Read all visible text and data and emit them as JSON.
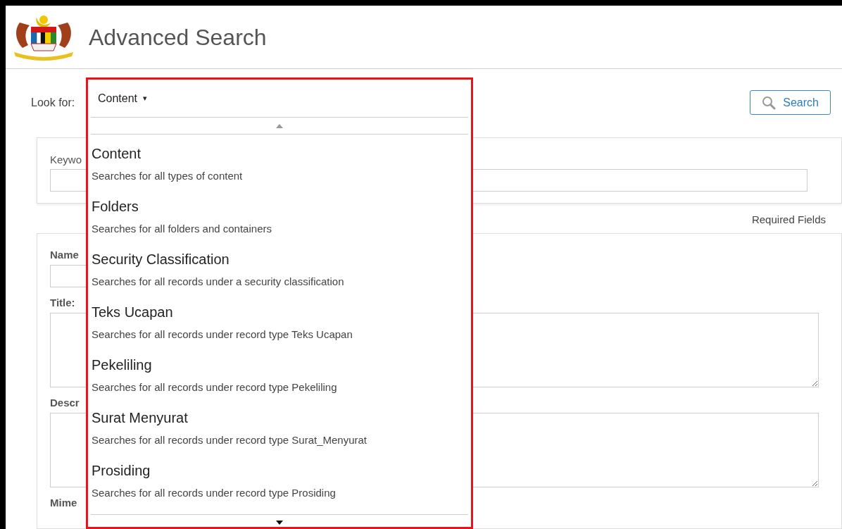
{
  "header": {
    "title": "Advanced Search"
  },
  "look_for": {
    "label": "Look for:",
    "value": "Content",
    "caret": "▾"
  },
  "search_button": {
    "label": "Search"
  },
  "dropdown": {
    "options": [
      {
        "label": "Content",
        "description": "Searches for all types of content"
      },
      {
        "label": "Folders",
        "description": "Searches for all folders and containers"
      },
      {
        "label": "Security Classification",
        "description": "Searches for all records under a security classification"
      },
      {
        "label": "Teks Ucapan",
        "description": "Searches for all records under record type Teks Ucapan"
      },
      {
        "label": "Pekeliling",
        "description": "Searches for all records under record type Pekeliling"
      },
      {
        "label": "Surat Menyurat",
        "description": "Searches for all records under record type Surat_Menyurat"
      },
      {
        "label": "Prosiding",
        "description": "Searches for all records under record type Prosiding"
      }
    ]
  },
  "keyword_panel": {
    "label": "Keywo"
  },
  "required_note": "Required Fields",
  "form_fields": [
    {
      "label": "Name",
      "kind": "input"
    },
    {
      "label": "Title:",
      "kind": "textarea"
    },
    {
      "label": "Descr",
      "kind": "textarea"
    },
    {
      "label": "Mime",
      "kind": "none"
    }
  ]
}
